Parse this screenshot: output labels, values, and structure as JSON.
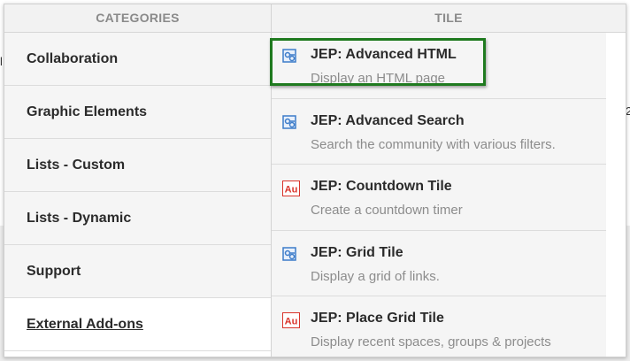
{
  "background": {
    "left_fragment": "l",
    "right_fragment": "2"
  },
  "headers": {
    "categories": "CATEGORIES",
    "tile": "TILE"
  },
  "categories": [
    {
      "label": "Collaboration"
    },
    {
      "label": "Graphic Elements"
    },
    {
      "label": "Lists - Custom"
    },
    {
      "label": "Lists - Dynamic"
    },
    {
      "label": "Support"
    },
    {
      "label": "External Add-ons",
      "selected": true
    }
  ],
  "tiles": [
    {
      "title": "JEP: Advanced HTML",
      "description": "Display an HTML page",
      "icon": "html-tile-icon",
      "highlighted": true
    },
    {
      "title": "JEP: Advanced Search",
      "description": "Search the community with various filters.",
      "icon": "html-tile-icon"
    },
    {
      "title": "JEP: Countdown Tile",
      "description": "Create a countdown timer",
      "icon": "addon-au-icon"
    },
    {
      "title": "JEP: Grid Tile",
      "description": "Display a grid of links.",
      "icon": "html-tile-icon"
    },
    {
      "title": "JEP: Place Grid Tile",
      "description": "Display recent spaces, groups & projects",
      "icon": "addon-au-icon"
    }
  ],
  "colors": {
    "highlight": "#1f7a1f",
    "icon_blue": "#3d7cc9",
    "icon_red": "#d9342b"
  },
  "scrollbar": {
    "up_icon": "chevron-up-icon",
    "down_icon": "chevron-down-icon"
  }
}
